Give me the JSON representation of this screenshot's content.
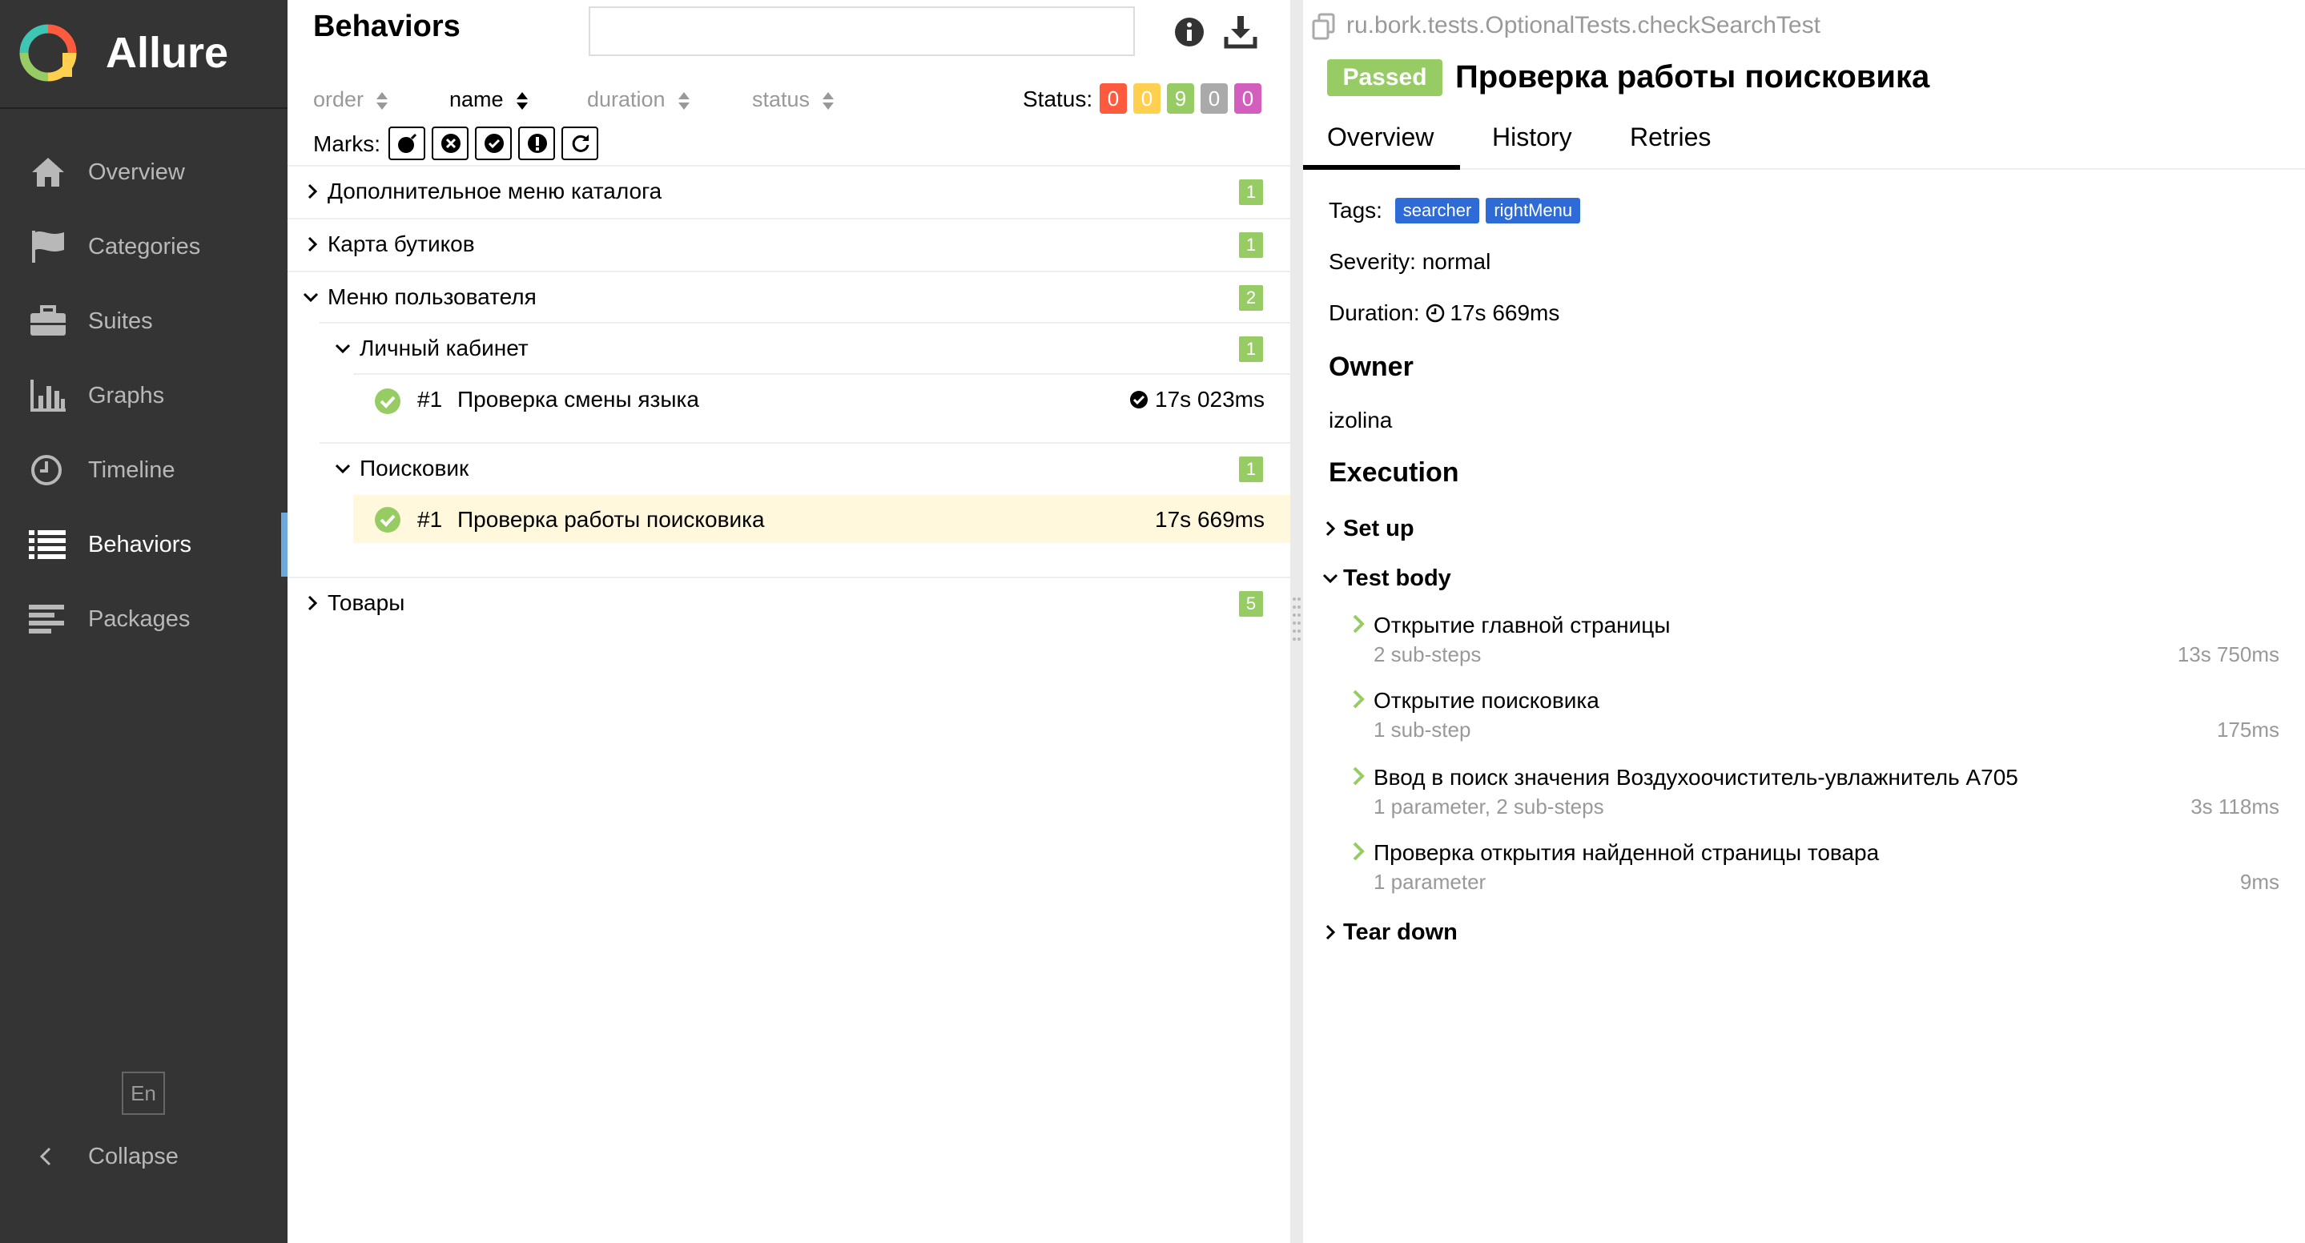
{
  "brand": {
    "name": "Allure"
  },
  "sidebar": {
    "items": [
      {
        "label": "Overview",
        "icon": "home-icon"
      },
      {
        "label": "Categories",
        "icon": "flag-icon"
      },
      {
        "label": "Suites",
        "icon": "briefcase-icon"
      },
      {
        "label": "Graphs",
        "icon": "bar-chart-icon"
      },
      {
        "label": "Timeline",
        "icon": "clock-icon"
      },
      {
        "label": "Behaviors",
        "icon": "list-icon",
        "active": true
      },
      {
        "label": "Packages",
        "icon": "align-left-icon"
      }
    ],
    "language": "En",
    "collapse_label": "Collapse"
  },
  "behaviors": {
    "title": "Behaviors",
    "search_value": "",
    "sort": {
      "order": "order",
      "name": "name",
      "duration": "duration",
      "status": "status"
    },
    "status_label": "Status:",
    "status_counts": [
      {
        "value": "0",
        "color": "#fd5a3e"
      },
      {
        "value": "0",
        "color": "#ffd050"
      },
      {
        "value": "9",
        "color": "#97cc64"
      },
      {
        "value": "0",
        "color": "#aaaaaa"
      },
      {
        "value": "0",
        "color": "#d35ebe"
      }
    ],
    "marks_label": "Marks:",
    "tree": {
      "catalog_menu": {
        "label": "Дополнительное меню каталога",
        "count": "1"
      },
      "boutique_map": {
        "label": "Карта бутиков",
        "count": "1"
      },
      "user_menu": {
        "label": "Меню пользователя",
        "count": "2"
      },
      "account": {
        "label": "Личный кабинет",
        "count": "1"
      },
      "account_test": {
        "num": "#1",
        "name": "Проверка смены языка",
        "duration": "17s 023ms"
      },
      "search": {
        "label": "Поисковик",
        "count": "1"
      },
      "search_test": {
        "num": "#1",
        "name": "Проверка работы поисковика",
        "duration": "17s 669ms"
      },
      "products": {
        "label": "Товары",
        "count": "5"
      }
    }
  },
  "details": {
    "full_name": "ru.bork.tests.OptionalTests.checkSearchTest",
    "status": "Passed",
    "title": "Проверка работы поисковика",
    "tabs": [
      "Overview",
      "History",
      "Retries"
    ],
    "tags_label": "Tags:",
    "tags": [
      "searcher",
      "rightMenu"
    ],
    "severity": "Severity: normal",
    "duration_label": "Duration:",
    "duration": "17s 669ms",
    "owner_heading": "Owner",
    "owner": "izolina",
    "execution_heading": "Execution",
    "setup": "Set up",
    "test_body": "Test body",
    "teardown": "Tear down",
    "steps": [
      {
        "name": "Открытие главной страницы",
        "sub": "2 sub-steps",
        "duration": "13s 750ms"
      },
      {
        "name": "Открытие поисковика",
        "sub": "1 sub-step",
        "duration": "175ms"
      },
      {
        "name": "Ввод в поиск значения Воздухоочиститель-увлажнитель A705",
        "sub": "1 parameter, 2 sub-steps",
        "duration": "3s 118ms"
      },
      {
        "name": "Проверка открытия найденной страницы товара",
        "sub": "1 parameter",
        "duration": "9ms"
      }
    ]
  }
}
